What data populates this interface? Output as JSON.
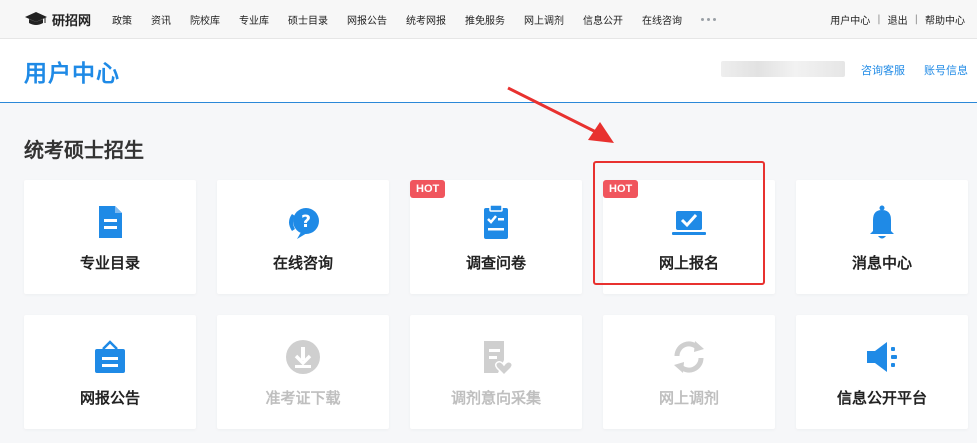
{
  "topnav": {
    "logo_text": "研招网",
    "links": [
      "政策",
      "资讯",
      "院校库",
      "专业库",
      "硕士目录",
      "网报公告",
      "统考网报",
      "推免服务",
      "网上调剂",
      "信息公开",
      "在线咨询"
    ],
    "right": [
      "用户中心",
      "退出",
      "帮助中心"
    ]
  },
  "header": {
    "title": "用户中心",
    "consult_link": "咨询客服",
    "account_link": "账号信息"
  },
  "section": {
    "title": "统考硕士招生"
  },
  "badge": {
    "hot": "HOT"
  },
  "cards": [
    {
      "label": "专业目录",
      "icon": "document-icon",
      "hot": false,
      "disabled": false
    },
    {
      "label": "在线咨询",
      "icon": "question-bubble-icon",
      "hot": false,
      "disabled": false
    },
    {
      "label": "调查问卷",
      "icon": "clipboard-check-icon",
      "hot": true,
      "disabled": false
    },
    {
      "label": "网上报名",
      "icon": "laptop-check-icon",
      "hot": true,
      "disabled": false
    },
    {
      "label": "消息中心",
      "icon": "bell-icon",
      "hot": false,
      "disabled": false
    },
    {
      "label": "网报公告",
      "icon": "notice-board-icon",
      "hot": false,
      "disabled": false
    },
    {
      "label": "准考证下载",
      "icon": "download-icon",
      "hot": false,
      "disabled": true
    },
    {
      "label": "调剂意向采集",
      "icon": "document-heart-icon",
      "hot": false,
      "disabled": true
    },
    {
      "label": "网上调剂",
      "icon": "refresh-icon",
      "hot": false,
      "disabled": true
    },
    {
      "label": "信息公开平台",
      "icon": "megaphone-icon",
      "hot": false,
      "disabled": false
    }
  ],
  "colors": {
    "accent": "#1f8ae6",
    "hot": "#f0555d",
    "highlight": "#e8312f",
    "disabled": "#bfbfbf"
  }
}
